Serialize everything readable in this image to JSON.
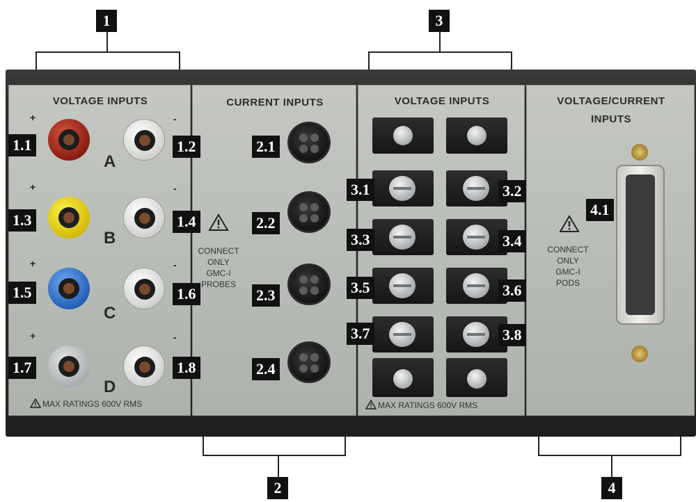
{
  "groups": [
    {
      "number": "1",
      "title": "VOLTAGE INPUTS"
    },
    {
      "number": "2",
      "title": "CURRENT INPUTS"
    },
    {
      "number": "3",
      "title": "VOLTAGE INPUTS"
    },
    {
      "number": "4",
      "title_line1": "VOLTAGE/CURRENT",
      "title_line2": "INPUTS"
    }
  ],
  "section1": {
    "plus": "+",
    "minus": "-",
    "channels": [
      "A",
      "B",
      "C",
      "D"
    ],
    "rating": "MAX RATINGS 600V RMS",
    "jack_colors": {
      "A": "red",
      "B": "yellow",
      "C": "blue",
      "D": "grey",
      "minus": "white"
    },
    "labels": [
      "1.1",
      "1.2",
      "1.3",
      "1.4",
      "1.5",
      "1.6",
      "1.7",
      "1.8"
    ]
  },
  "section2": {
    "note": [
      "CONNECT",
      "ONLY",
      "GMC-I",
      "PROBES"
    ],
    "labels": [
      "2.1",
      "2.2",
      "2.3",
      "2.4"
    ]
  },
  "section3": {
    "rating": "MAX RATINGS 600V RMS",
    "labels": [
      "3.1",
      "3.2",
      "3.3",
      "3.4",
      "3.5",
      "3.6",
      "3.7",
      "3.8"
    ]
  },
  "section4": {
    "note": [
      "CONNECT",
      "ONLY",
      "GMC-I",
      "PODS"
    ],
    "labels": [
      "4.1"
    ]
  },
  "colors": {
    "panel": "#bcc0bb",
    "chassis": "#2b2b29",
    "label_bg": "#111111"
  }
}
